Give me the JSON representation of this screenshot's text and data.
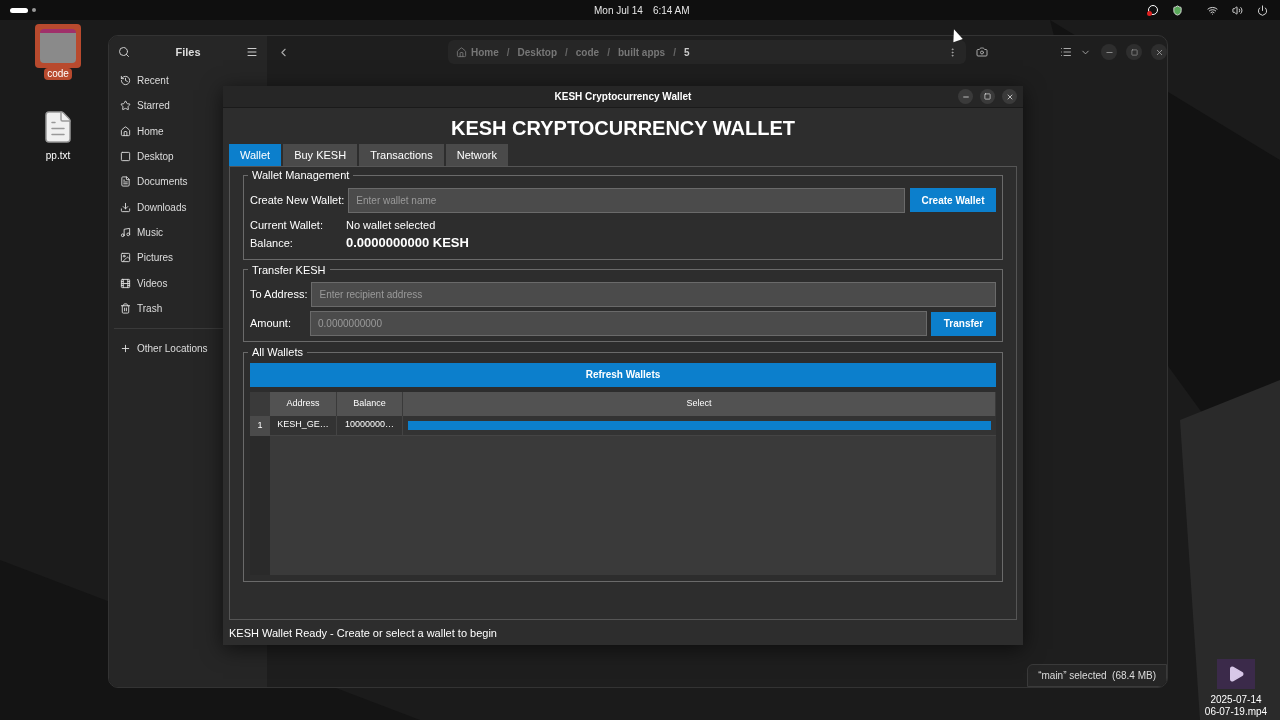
{
  "top_bar": {
    "date": "Mon Jul 14",
    "time": "6:14 AM"
  },
  "desktop_icons": [
    {
      "label": "code",
      "kind": "folder",
      "selected": true
    },
    {
      "label": "pp.txt",
      "kind": "text",
      "selected": false
    },
    {
      "label": "2025-07-14 06-07-19.mp4",
      "kind": "video",
      "selected": false
    }
  ],
  "files_window": {
    "title": "Files",
    "sidebar": [
      {
        "label": "Recent",
        "kind": "recent"
      },
      {
        "label": "Starred",
        "kind": "starred"
      },
      {
        "label": "Home",
        "kind": "home"
      },
      {
        "label": "Desktop",
        "kind": "desktop"
      },
      {
        "label": "Documents",
        "kind": "documents"
      },
      {
        "label": "Downloads",
        "kind": "downloads"
      },
      {
        "label": "Music",
        "kind": "music"
      },
      {
        "label": "Pictures",
        "kind": "pictures"
      },
      {
        "label": "Videos",
        "kind": "videos"
      },
      {
        "label": "Trash",
        "kind": "trash"
      },
      {
        "label": "Other Locations",
        "kind": "other"
      }
    ],
    "breadcrumb": [
      "Home",
      "Desktop",
      "code",
      "built apps",
      "5"
    ],
    "separator": "/",
    "status": "“main” selected  (68.4 MB)"
  },
  "wallet_window": {
    "title": "KESH Cryptocurrency Wallet",
    "heading": "KESH CRYPTOCURRENCY WALLET",
    "tabs": [
      {
        "label": "Wallet",
        "selected": true
      },
      {
        "label": "Buy KESH",
        "selected": false
      },
      {
        "label": "Transactions",
        "selected": false
      },
      {
        "label": "Network",
        "selected": false
      }
    ],
    "wallet_management": {
      "legend": "Wallet Management",
      "create_label": "Create New Wallet:",
      "name_placeholder": "Enter wallet name",
      "create_button": "Create Wallet",
      "current_label": "Current Wallet:",
      "current_value": "No wallet selected",
      "balance_label": "Balance:",
      "balance_value": "0.0000000000 KESH"
    },
    "transfer": {
      "legend": "Transfer KESH",
      "to_label": "To Address:",
      "to_placeholder": "Enter recipient address",
      "amount_label": "Amount:",
      "amount_placeholder": "0.0000000000",
      "button": "Transfer"
    },
    "all_wallets": {
      "legend": "All Wallets",
      "refresh_button": "Refresh Wallets",
      "columns": [
        "Address",
        "Balance",
        "Select"
      ],
      "rows": [
        {
          "index": "1",
          "address": "KESH_GE…",
          "balance": "10000000…"
        }
      ]
    },
    "status": "KESH Wallet Ready - Create or select a wallet to begin"
  }
}
